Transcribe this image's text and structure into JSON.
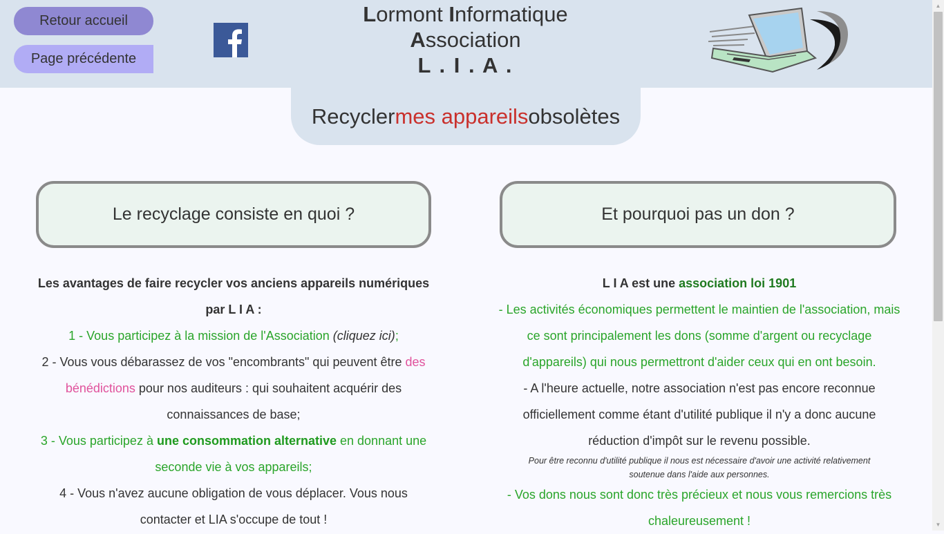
{
  "header": {
    "home_button": "Retour accueil",
    "prev_button": "Page précédente",
    "brand_line1_cap1": "L",
    "brand_line1_rest1": "ormont ",
    "brand_line1_cap2": "I",
    "brand_line1_rest2": "nformatique",
    "brand_line2_cap": "A",
    "brand_line2_rest": "ssociation",
    "brand_acronym": "L . I . A ."
  },
  "page_title": {
    "part1": "Recycler ",
    "part2": "mes appareils",
    "part3": " obsolètes"
  },
  "left": {
    "box_title": "Le recyclage consiste en quoi ?",
    "intro": "Les avantages de faire recycler vos anciens appareils numériques par L I A :",
    "item1_text": "1 - Vous participez à la mission de l'Association ",
    "item1_link": "(cliquez ici)",
    "item1_end": ";",
    "item2_a": "2 - Vous vous débarassez de vos \"encombrants\" qui peuvent être ",
    "item2_highlight": "des bénédictions",
    "item2_b": " pour nos auditeurs : qui souhaitent acquérir des connaissances de base;",
    "item3_a": "3 - Vous participez à ",
    "item3_bold": "une consommation alternative",
    "item3_b": " en donnant une seconde vie à vos appareils;",
    "item4": "4 - Vous n'avez aucune obligation de vous déplacer. Vous nous contacter et LIA s'occupe de tout !"
  },
  "right": {
    "box_title": "Et pourquoi pas un don ?",
    "intro_a": "L I A est une ",
    "intro_b": "association loi 1901",
    "para1": "- Les activités économiques permettent le maintien de l'association, mais ce sont principalement les dons (somme d'argent ou recyclage d'appareils) qui nous permettront d'aider ceux qui en ont besoin.",
    "para2": "- A l'heure actuelle, notre association n'est pas encore reconnue officiellement comme étant d'utilité publique il n'y a donc aucune réduction d'impôt sur le revenu possible.",
    "note": "Pour être reconnu d'utilité publique il nous est nécessaire d'avoir une activité relativement soutenue dans l'aide aux personnes.",
    "para3": "- Vos dons nous sont donc très précieux et nous vous remercions très chaleureusement !"
  },
  "icons": {
    "facebook": "facebook-icon",
    "laptop": "laptop-logo"
  },
  "colors": {
    "header_bg": "#d9e3ee",
    "accent_red": "#c9302c",
    "green": "#2aa52a",
    "button_home": "#8f88d2",
    "button_prev": "#b1acf5"
  }
}
